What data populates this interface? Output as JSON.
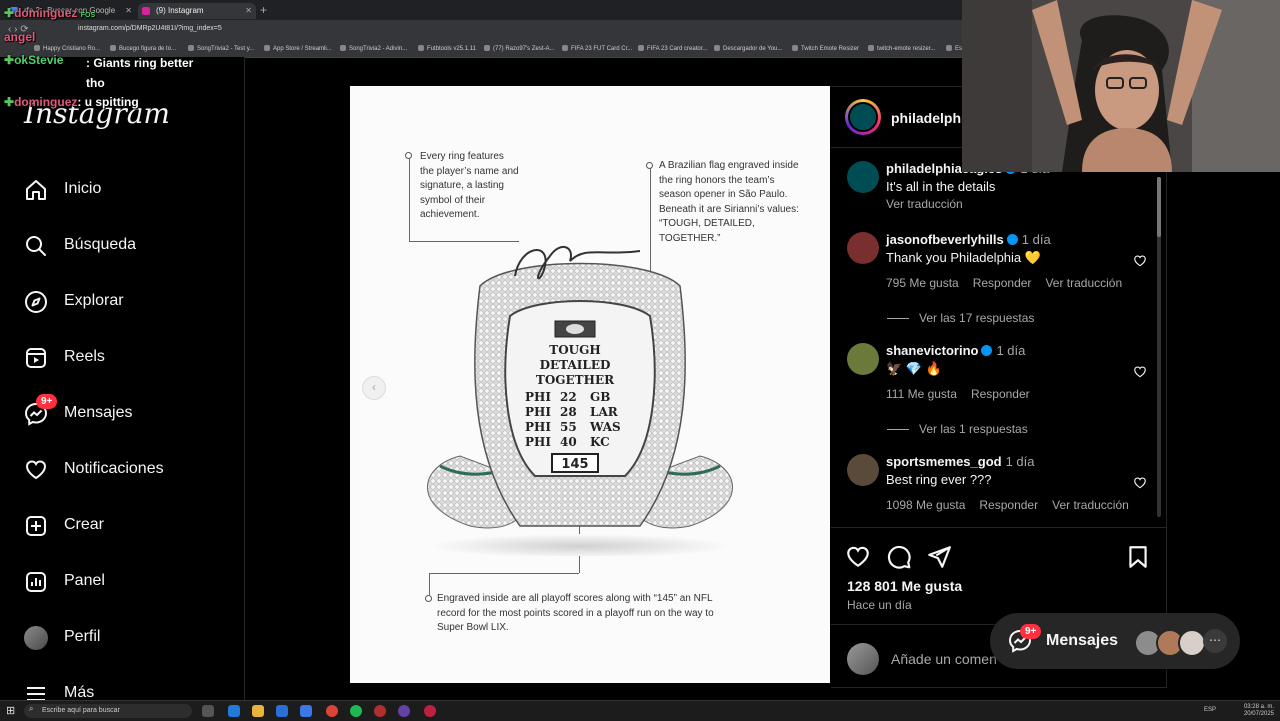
{
  "browser": {
    "tabs": [
      {
        "label": "rfa 2 - Buscar con Google"
      },
      {
        "label": "(9) Instagram"
      }
    ],
    "url": "instagram.com/p/DMRp2U4t81I/?img_index=5",
    "bookmarks": [
      "Happy Cristiano Ro...",
      "Bucego figura de to...",
      "SongTrivia2 - Test y...",
      "App Store / Streamli...",
      "SongTrivia2 - Adivin...",
      "Futbtools v25.1.11",
      "(77) Razo97's Zest-A...",
      "FIFA 23 FUT Card Cr...",
      "FIFA 23 Card creator...",
      "Descargador de You...",
      "Twitch Emote Resizer",
      "twitch-emote resizer...",
      "Est"
    ]
  },
  "chat": [
    {
      "user": "dominguez",
      "badge": "FOS",
      "text": ""
    },
    {
      "user": "angel",
      "text": ""
    },
    {
      "user": "okStevie",
      "text": ": Giants ring better tho"
    },
    {
      "user": "dominguez",
      "text": ": u spitting"
    }
  ],
  "sidebar": {
    "logo": "Instagram",
    "items": [
      {
        "label": "Inicio",
        "icon": "home-icon"
      },
      {
        "label": "Búsqueda",
        "icon": "search-icon"
      },
      {
        "label": "Explorar",
        "icon": "compass-icon"
      },
      {
        "label": "Reels",
        "icon": "reels-icon"
      },
      {
        "label": "Mensajes",
        "icon": "messenger-icon",
        "badge": "9+"
      },
      {
        "label": "Notificaciones",
        "icon": "heart-icon"
      },
      {
        "label": "Crear",
        "icon": "plus-square-icon"
      },
      {
        "label": "Panel",
        "icon": "chart-icon"
      },
      {
        "label": "Perfil",
        "icon": "avatar"
      },
      {
        "label": "Más",
        "icon": "menu-icon"
      }
    ]
  },
  "post_image": {
    "captions": [
      "Every ring features the player’s name and signature, a lasting symbol of their achievement.",
      "A Brazilian flag engraved inside the ring honors the team’s season opener in São Paulo. Beneath it are Sirianni’s values: “TOUGH, DETAILED, TOGETHER.”",
      "Engraved inside are all playoff scores along with “145” an NFL record for the most points scored in a playoff run on the way to Super Bowl LIX."
    ],
    "ring_text": [
      "TOUGH",
      "DETAILED",
      "TOGETHER"
    ],
    "ring_scores_left": [
      "PHI",
      "PHI",
      "PHI",
      "PHI"
    ],
    "ring_scores_mid": [
      "22",
      "28",
      "55",
      "40"
    ],
    "ring_scores_right": [
      "GB",
      "LAR",
      "WAS",
      "KC"
    ],
    "ring_total": "145"
  },
  "panel": {
    "account": "philadelphi",
    "caption": {
      "user": "philadelphiaeagles",
      "time": "1 día",
      "text": "It's all in the details",
      "translate": "Ver traducción"
    },
    "comments": [
      {
        "user": "jasonofbeverlyhills",
        "time": "1 día",
        "text": "Thank you Philadelphia 💛",
        "likes": "795 Me gusta",
        "reply": "Responder",
        "translate": "Ver traducción",
        "replies": "Ver las 17 respuestas",
        "avatar_color": "#7a2f2f"
      },
      {
        "user": "shanevictorino",
        "time": "1 día",
        "text": "🦅 💎 🔥",
        "likes": "111 Me gusta",
        "reply": "Responder",
        "translate": "",
        "replies": "Ver las 1 respuestas",
        "avatar_color": "#6b7a3a"
      },
      {
        "user": "sportsmemes_god",
        "time": "1 día",
        "text": "Best ring ever ???",
        "likes": "1098 Me gusta",
        "reply": "Responder",
        "translate": "Ver traducción",
        "replies": "",
        "avatar_color": "#5a4a3a"
      }
    ],
    "likes": "128 801 Me gusta",
    "posted": "Hace un día",
    "add_comment": "Añade un comen"
  },
  "messages_pill": {
    "label": "Mensajes",
    "badge": "9+"
  },
  "taskbar": {
    "search": "Escribe aquí para buscar",
    "time": "03:28 a. m.",
    "date": "20/07/2025",
    "lang": "ESP"
  },
  "colors": {
    "accent": "#0095f6",
    "badge": "#ff3040",
    "bg": "#000000"
  }
}
